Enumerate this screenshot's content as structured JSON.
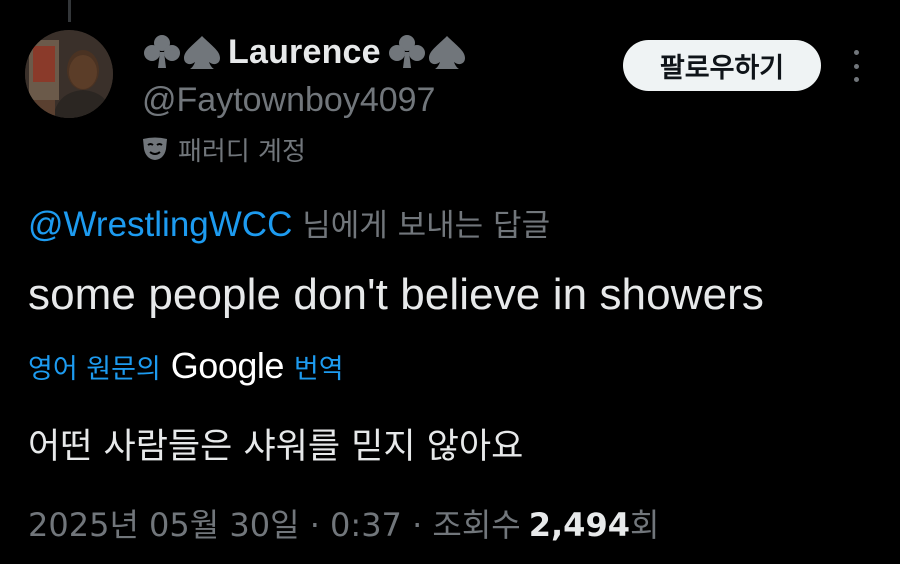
{
  "user": {
    "display_name": "Laurence",
    "handle": "@Faytownboy4097",
    "parody_label": "패러디 계정"
  },
  "actions": {
    "follow_label": "팔로우하기"
  },
  "reply": {
    "mention": "@WrestlingWCC",
    "context_suffix": "님에게 보내는 답글"
  },
  "tweet": {
    "text": "some people don't believe in showers"
  },
  "translation": {
    "prefix": "영어 원문의",
    "brand": "Google",
    "suffix": "번역",
    "text": "어떤 사람들은 샤워를 믿지 않아요"
  },
  "meta": {
    "timestamp": "2025년 05월 30일 · 0:37 · 조회수",
    "views": "2,494",
    "views_suffix": "회"
  },
  "icons": {
    "suit_left_1": "club-icon",
    "suit_left_2": "spade-icon",
    "suit_right_1": "club-icon",
    "suit_right_2": "spade-icon",
    "parody": "theater-mask-icon",
    "more": "more-vertical-icon"
  },
  "colors": {
    "background": "#000000",
    "text_primary": "#e7e9ea",
    "text_secondary": "#71767b",
    "link": "#1d9bf0",
    "follow_button_bg": "#eff3f4"
  }
}
